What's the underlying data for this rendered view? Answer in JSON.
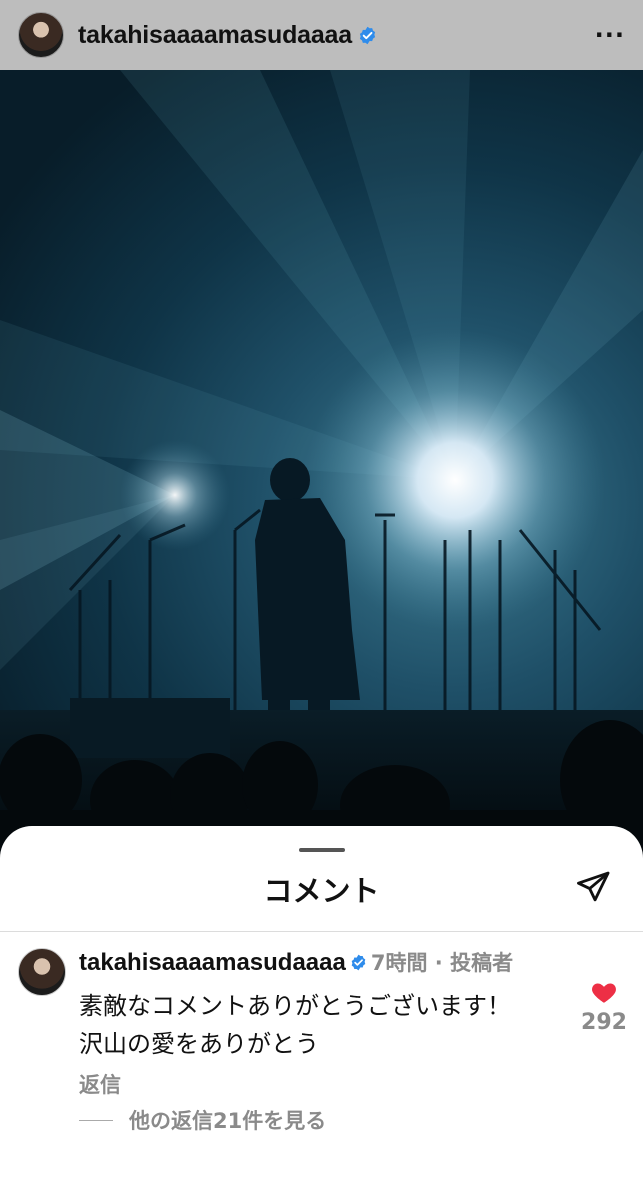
{
  "post": {
    "username": "takahisaaaamasudaaaa",
    "more_label": "···"
  },
  "comments_sheet": {
    "title": "コメント"
  },
  "comment": {
    "username": "takahisaaaamasudaaaa",
    "meta": "7時間 · 投稿者",
    "text_line1": "素敵なコメントありがとうございます！",
    "text_line2": "沢山の愛をありがとう",
    "reply_label": "返信",
    "view_replies_label": "他の返信21件を見る",
    "like_count": "292"
  },
  "colors": {
    "verified": "#2f8ceb",
    "heart": "#ed2f45",
    "header_bg": "#bdbdbd"
  },
  "icons": {
    "verified": "verified-badge-icon",
    "send": "paper-plane-icon",
    "like": "heart-icon",
    "more": "more-horizontal-icon"
  }
}
